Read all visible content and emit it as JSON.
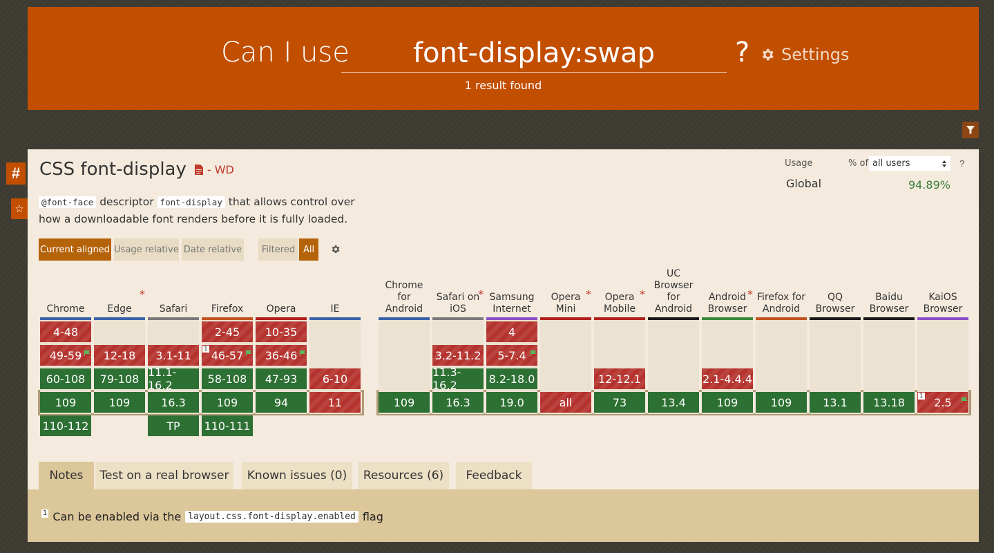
{
  "header": {
    "prefix": "Can I use",
    "query": "font-display:swap",
    "question": "?",
    "settings": "Settings",
    "result": "1 result found"
  },
  "side": {
    "hash": "#",
    "star": "☆"
  },
  "feature": {
    "title": "CSS font-display",
    "status": "- WD",
    "desc_code1": "@font-face",
    "desc_text1": " descriptor ",
    "desc_code2": "font-display",
    "desc_text2": " that allows control over how a downloadable font renders before it is fully loaded."
  },
  "usage": {
    "label": "Usage",
    "pct_of": "% of",
    "select": "all users",
    "help": "?",
    "region": "Global",
    "pct": "94.89%"
  },
  "toggles": {
    "current": "Current aligned",
    "usage": "Usage relative",
    "date": "Date relative",
    "filtered": "Filtered",
    "all": "All"
  },
  "browsers": [
    {
      "name": "Chrome",
      "bar": "#3a62a8",
      "cells": [
        {
          "r": 0,
          "t": "4-48",
          "s": "n"
        },
        {
          "r": 1,
          "t": "49-59",
          "s": "n",
          "flag": true
        },
        {
          "r": 2,
          "t": "60-108",
          "s": "y"
        },
        {
          "r": 3,
          "t": "109",
          "s": "y"
        },
        {
          "r": 4,
          "t": "110-112",
          "s": "y"
        }
      ]
    },
    {
      "name": "Edge",
      "bar": "#3a62a8",
      "star": true,
      "cells": [
        {
          "r": 1,
          "t": "12-18",
          "s": "n"
        },
        {
          "r": 2,
          "t": "79-108",
          "s": "y"
        },
        {
          "r": 3,
          "t": "109",
          "s": "y"
        }
      ]
    },
    {
      "name": "Safari",
      "bar": "#7a7a7a",
      "cells": [
        {
          "r": 1,
          "t": "3.1-11",
          "s": "n"
        },
        {
          "r": 2,
          "t": "11.1-16.2",
          "s": "y"
        },
        {
          "r": 3,
          "t": "16.3",
          "s": "y"
        },
        {
          "r": 4,
          "t": "TP",
          "s": "y"
        }
      ]
    },
    {
      "name": "Firefox",
      "bar": "#c2531f",
      "cells": [
        {
          "r": 0,
          "t": "2-45",
          "s": "n"
        },
        {
          "r": 1,
          "t": "46-57",
          "s": "n",
          "flag": true,
          "note": "1"
        },
        {
          "r": 2,
          "t": "58-108",
          "s": "y"
        },
        {
          "r": 3,
          "t": "109",
          "s": "y"
        },
        {
          "r": 4,
          "t": "110-111",
          "s": "y"
        }
      ]
    },
    {
      "name": "Opera",
      "bar": "#b0201c",
      "cells": [
        {
          "r": 0,
          "t": "10-35",
          "s": "n"
        },
        {
          "r": 1,
          "t": "36-46",
          "s": "n",
          "flag": true
        },
        {
          "r": 2,
          "t": "47-93",
          "s": "y"
        },
        {
          "r": 3,
          "t": "94",
          "s": "y"
        }
      ]
    },
    {
      "name": "IE",
      "bar": "#3a62a8",
      "cells": [
        {
          "r": 2,
          "t": "6-10",
          "s": "n"
        },
        {
          "r": 3,
          "t": "11",
          "s": "n"
        }
      ]
    },
    {
      "name": "Chrome for Android",
      "bar": "#3a62a8",
      "cells": [
        {
          "r": 3,
          "t": "109",
          "s": "y"
        }
      ]
    },
    {
      "name": "Safari on iOS",
      "bar": "#7a7a7a",
      "star": true,
      "cells": [
        {
          "r": 1,
          "t": "3.2-11.2",
          "s": "n"
        },
        {
          "r": 2,
          "t": "11.3-16.2",
          "s": "y"
        },
        {
          "r": 3,
          "t": "16.3",
          "s": "y"
        }
      ]
    },
    {
      "name": "Samsung Internet",
      "bar": "#8b4fc4",
      "cells": [
        {
          "r": 0,
          "t": "4",
          "s": "n"
        },
        {
          "r": 1,
          "t": "5-7.4",
          "s": "n",
          "flag": true
        },
        {
          "r": 2,
          "t": "8.2-18.0",
          "s": "y"
        },
        {
          "r": 3,
          "t": "19.0",
          "s": "y"
        }
      ]
    },
    {
      "name": "Opera Mini",
      "bar": "#b0201c",
      "star": true,
      "cells": [
        {
          "r": 3,
          "t": "all",
          "s": "n"
        }
      ]
    },
    {
      "name": "Opera Mobile",
      "bar": "#b0201c",
      "star": true,
      "cells": [
        {
          "r": 2,
          "t": "12-12.1",
          "s": "n"
        },
        {
          "r": 3,
          "t": "73",
          "s": "y"
        }
      ]
    },
    {
      "name": "UC Browser for Android",
      "bar": "#1a1a1a",
      "cells": [
        {
          "r": 3,
          "t": "13.4",
          "s": "y"
        }
      ]
    },
    {
      "name": "Android Browser",
      "bar": "#3a8a3a",
      "star": true,
      "cells": [
        {
          "r": 2,
          "t": "2.1-4.4.4",
          "s": "n"
        },
        {
          "r": 3,
          "t": "109",
          "s": "y"
        }
      ]
    },
    {
      "name": "Firefox for Android",
      "bar": "#c2531f",
      "cells": [
        {
          "r": 3,
          "t": "109",
          "s": "y"
        }
      ]
    },
    {
      "name": "QQ Browser",
      "bar": "#1a1a1a",
      "cells": [
        {
          "r": 3,
          "t": "13.1",
          "s": "y"
        }
      ]
    },
    {
      "name": "Baidu Browser",
      "bar": "#1a1a1a",
      "cells": [
        {
          "r": 3,
          "t": "13.18",
          "s": "y"
        }
      ]
    },
    {
      "name": "KaiOS Browser",
      "bar": "#8b4fc4",
      "cells": [
        {
          "r": 3,
          "t": "2.5",
          "s": "n",
          "flag": true,
          "note": "1"
        }
      ]
    }
  ],
  "tabs": [
    "Notes",
    "Test on a real browser",
    "Known issues (0)",
    "Resources (6)",
    "Feedback"
  ],
  "notes": {
    "num": "1",
    "text1": "Can be enabled via the",
    "code": "layout.css.font-display.enabled",
    "text2": "flag"
  },
  "colors": {
    "brand": "#c24e00",
    "supported": "#2d7033",
    "unsupported": "#b5332e",
    "toggle_active": "#b5630a"
  }
}
